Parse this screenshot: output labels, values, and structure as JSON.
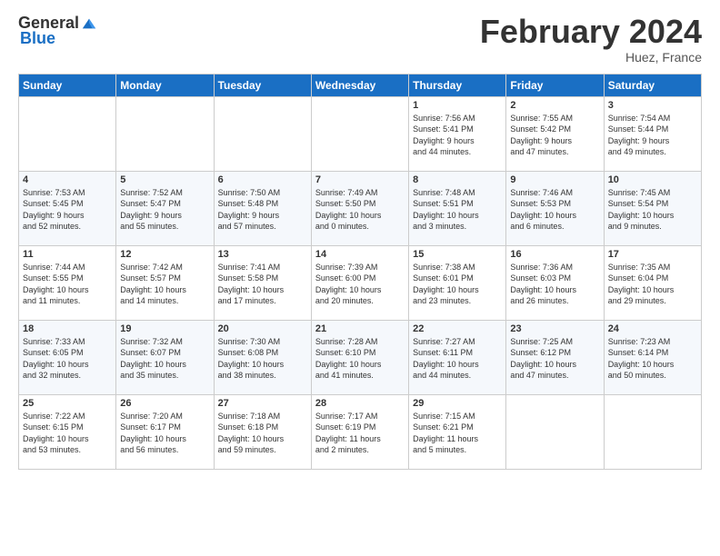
{
  "header": {
    "logo_general": "General",
    "logo_blue": "Blue",
    "title": "February 2024",
    "subtitle": "Huez, France"
  },
  "columns": [
    "Sunday",
    "Monday",
    "Tuesday",
    "Wednesday",
    "Thursday",
    "Friday",
    "Saturday"
  ],
  "weeks": [
    [
      {
        "day": "",
        "info": ""
      },
      {
        "day": "",
        "info": ""
      },
      {
        "day": "",
        "info": ""
      },
      {
        "day": "",
        "info": ""
      },
      {
        "day": "1",
        "info": "Sunrise: 7:56 AM\nSunset: 5:41 PM\nDaylight: 9 hours\nand 44 minutes."
      },
      {
        "day": "2",
        "info": "Sunrise: 7:55 AM\nSunset: 5:42 PM\nDaylight: 9 hours\nand 47 minutes."
      },
      {
        "day": "3",
        "info": "Sunrise: 7:54 AM\nSunset: 5:44 PM\nDaylight: 9 hours\nand 49 minutes."
      }
    ],
    [
      {
        "day": "4",
        "info": "Sunrise: 7:53 AM\nSunset: 5:45 PM\nDaylight: 9 hours\nand 52 minutes."
      },
      {
        "day": "5",
        "info": "Sunrise: 7:52 AM\nSunset: 5:47 PM\nDaylight: 9 hours\nand 55 minutes."
      },
      {
        "day": "6",
        "info": "Sunrise: 7:50 AM\nSunset: 5:48 PM\nDaylight: 9 hours\nand 57 minutes."
      },
      {
        "day": "7",
        "info": "Sunrise: 7:49 AM\nSunset: 5:50 PM\nDaylight: 10 hours\nand 0 minutes."
      },
      {
        "day": "8",
        "info": "Sunrise: 7:48 AM\nSunset: 5:51 PM\nDaylight: 10 hours\nand 3 minutes."
      },
      {
        "day": "9",
        "info": "Sunrise: 7:46 AM\nSunset: 5:53 PM\nDaylight: 10 hours\nand 6 minutes."
      },
      {
        "day": "10",
        "info": "Sunrise: 7:45 AM\nSunset: 5:54 PM\nDaylight: 10 hours\nand 9 minutes."
      }
    ],
    [
      {
        "day": "11",
        "info": "Sunrise: 7:44 AM\nSunset: 5:55 PM\nDaylight: 10 hours\nand 11 minutes."
      },
      {
        "day": "12",
        "info": "Sunrise: 7:42 AM\nSunset: 5:57 PM\nDaylight: 10 hours\nand 14 minutes."
      },
      {
        "day": "13",
        "info": "Sunrise: 7:41 AM\nSunset: 5:58 PM\nDaylight: 10 hours\nand 17 minutes."
      },
      {
        "day": "14",
        "info": "Sunrise: 7:39 AM\nSunset: 6:00 PM\nDaylight: 10 hours\nand 20 minutes."
      },
      {
        "day": "15",
        "info": "Sunrise: 7:38 AM\nSunset: 6:01 PM\nDaylight: 10 hours\nand 23 minutes."
      },
      {
        "day": "16",
        "info": "Sunrise: 7:36 AM\nSunset: 6:03 PM\nDaylight: 10 hours\nand 26 minutes."
      },
      {
        "day": "17",
        "info": "Sunrise: 7:35 AM\nSunset: 6:04 PM\nDaylight: 10 hours\nand 29 minutes."
      }
    ],
    [
      {
        "day": "18",
        "info": "Sunrise: 7:33 AM\nSunset: 6:05 PM\nDaylight: 10 hours\nand 32 minutes."
      },
      {
        "day": "19",
        "info": "Sunrise: 7:32 AM\nSunset: 6:07 PM\nDaylight: 10 hours\nand 35 minutes."
      },
      {
        "day": "20",
        "info": "Sunrise: 7:30 AM\nSunset: 6:08 PM\nDaylight: 10 hours\nand 38 minutes."
      },
      {
        "day": "21",
        "info": "Sunrise: 7:28 AM\nSunset: 6:10 PM\nDaylight: 10 hours\nand 41 minutes."
      },
      {
        "day": "22",
        "info": "Sunrise: 7:27 AM\nSunset: 6:11 PM\nDaylight: 10 hours\nand 44 minutes."
      },
      {
        "day": "23",
        "info": "Sunrise: 7:25 AM\nSunset: 6:12 PM\nDaylight: 10 hours\nand 47 minutes."
      },
      {
        "day": "24",
        "info": "Sunrise: 7:23 AM\nSunset: 6:14 PM\nDaylight: 10 hours\nand 50 minutes."
      }
    ],
    [
      {
        "day": "25",
        "info": "Sunrise: 7:22 AM\nSunset: 6:15 PM\nDaylight: 10 hours\nand 53 minutes."
      },
      {
        "day": "26",
        "info": "Sunrise: 7:20 AM\nSunset: 6:17 PM\nDaylight: 10 hours\nand 56 minutes."
      },
      {
        "day": "27",
        "info": "Sunrise: 7:18 AM\nSunset: 6:18 PM\nDaylight: 10 hours\nand 59 minutes."
      },
      {
        "day": "28",
        "info": "Sunrise: 7:17 AM\nSunset: 6:19 PM\nDaylight: 11 hours\nand 2 minutes."
      },
      {
        "day": "29",
        "info": "Sunrise: 7:15 AM\nSunset: 6:21 PM\nDaylight: 11 hours\nand 5 minutes."
      },
      {
        "day": "",
        "info": ""
      },
      {
        "day": "",
        "info": ""
      }
    ]
  ]
}
